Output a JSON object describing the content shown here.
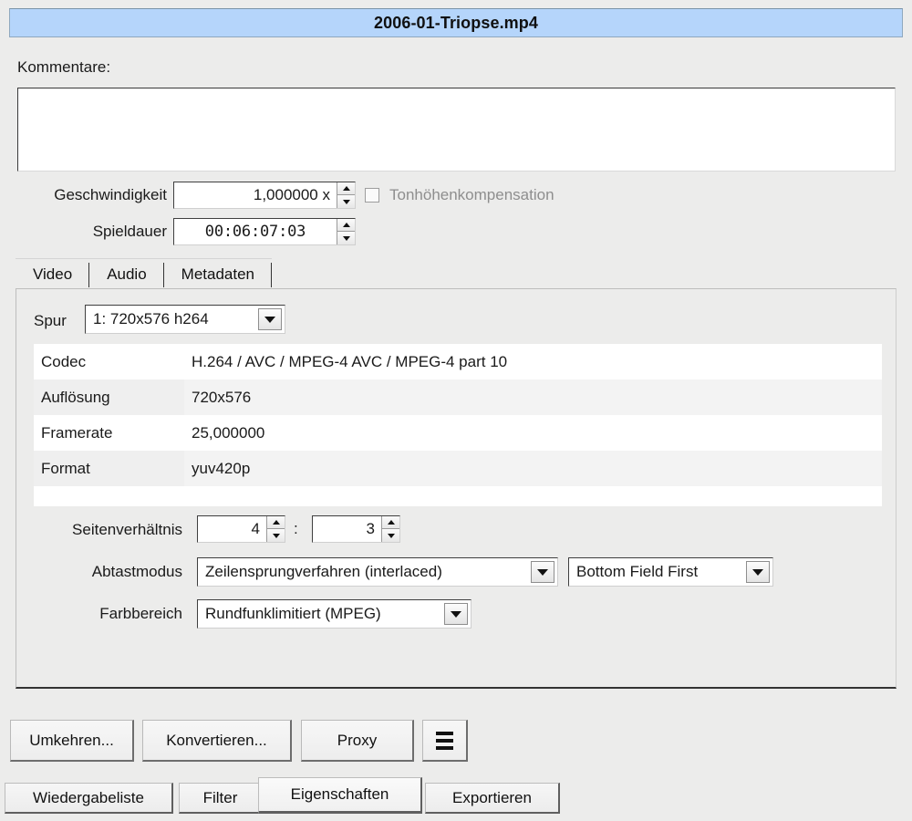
{
  "window": {
    "title": "2006-01-Triopse.mp4"
  },
  "comments": {
    "label": "Kommentare:",
    "value": "",
    "placeholder": ""
  },
  "speed": {
    "label": "Geschwindigkeit",
    "value": "1,000000 x",
    "pitch_compensation_label": "Tonhöhenkompensation",
    "pitch_compensation_checked": false,
    "pitch_compensation_enabled": false
  },
  "duration": {
    "label": "Spieldauer",
    "value": "00:06:07:03"
  },
  "tabs": [
    {
      "label": "Video",
      "active": true
    },
    {
      "label": "Audio",
      "active": false
    },
    {
      "label": "Metadaten",
      "active": false
    }
  ],
  "track": {
    "label": "Spur",
    "value": "1: 720x576 h264"
  },
  "properties": [
    {
      "key": "Codec",
      "value": "H.264 / AVC / MPEG-4 AVC / MPEG-4 part 10"
    },
    {
      "key": "Auflösung",
      "value": "720x576"
    },
    {
      "key": "Framerate",
      "value": "25,000000"
    },
    {
      "key": "Format",
      "value": "yuv420p"
    }
  ],
  "aspect_ratio": {
    "label": "Seitenverhältnis",
    "numerator": "4",
    "separator": ":",
    "denominator": "3"
  },
  "scan_mode": {
    "label": "Abtastmodus",
    "value": "Zeilensprungverfahren (interlaced)",
    "field_order_value": "Bottom Field First"
  },
  "color_range": {
    "label": "Farbbereich",
    "value": "Rundfunklimitiert (MPEG)"
  },
  "actions": [
    {
      "label": "Umkehren...",
      "name": "reverse-button"
    },
    {
      "label": "Konvertieren...",
      "name": "convert-button"
    },
    {
      "label": "Proxy",
      "name": "proxy-button"
    }
  ],
  "menu_button": {
    "icon": "hamburger-menu-icon"
  },
  "bottom_tabs": [
    {
      "label": "Wiedergabeliste",
      "active": false
    },
    {
      "label": "Filter",
      "active": false
    },
    {
      "label": "Eigenschaften",
      "active": true
    },
    {
      "label": "Exportieren",
      "active": false
    }
  ],
  "colors": {
    "titlebar": "#b5d5fb",
    "background": "#ececeb",
    "field_bg": "#ffffff",
    "disabled_text": "#8e8e8e"
  }
}
